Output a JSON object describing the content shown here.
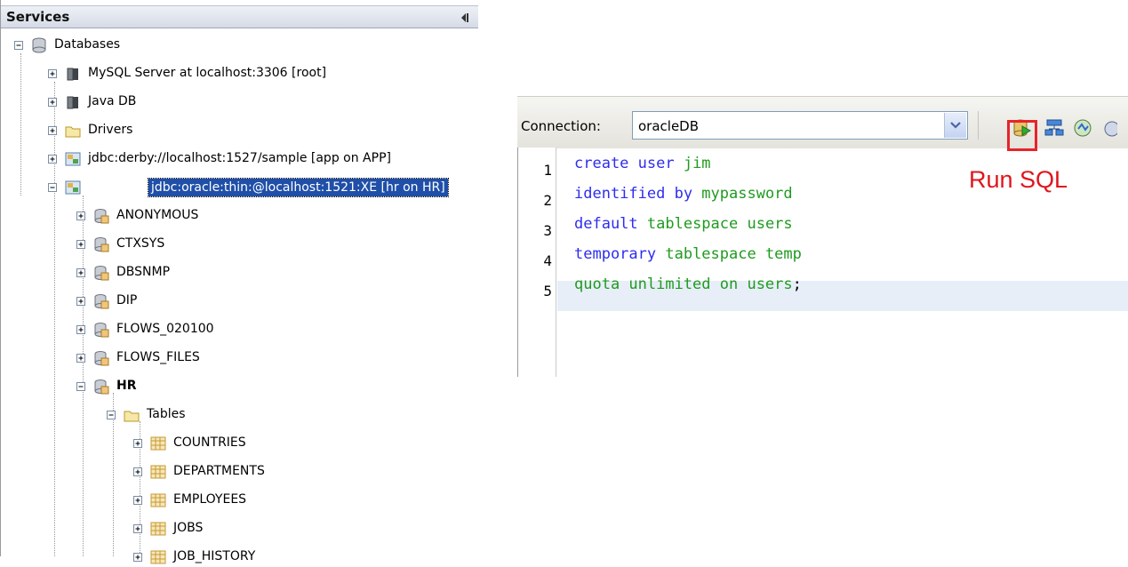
{
  "services": {
    "title": "Services",
    "tree": [
      {
        "label": "Databases",
        "icon": "database-icon"
      },
      {
        "label": "MySQL Server at localhost:3306 [root]",
        "icon": "mysql-server-icon"
      },
      {
        "label": "Java DB",
        "icon": "java-db-icon"
      },
      {
        "label": "Drivers",
        "icon": "folder-icon"
      },
      {
        "label": "jdbc:derby://localhost:1527/sample [app on APP]",
        "icon": "connection-icon"
      },
      {
        "label": "jdbc:oracle:thin:@localhost:1521:XE [hr on HR]",
        "icon": "connection-icon",
        "selected": true
      },
      {
        "label": "ANONYMOUS",
        "icon": "schema-icon"
      },
      {
        "label": "CTXSYS",
        "icon": "schema-icon"
      },
      {
        "label": "DBSNMP",
        "icon": "schema-icon"
      },
      {
        "label": "DIP",
        "icon": "schema-icon"
      },
      {
        "label": "FLOWS_020100",
        "icon": "schema-icon"
      },
      {
        "label": "FLOWS_FILES",
        "icon": "schema-icon"
      },
      {
        "label": "HR",
        "icon": "schema-icon",
        "bold": true
      },
      {
        "label": "Tables",
        "icon": "folder-icon"
      },
      {
        "label": "COUNTRIES",
        "icon": "table-icon"
      },
      {
        "label": "DEPARTMENTS",
        "icon": "table-icon"
      },
      {
        "label": "EMPLOYEES",
        "icon": "table-icon"
      },
      {
        "label": "JOBS",
        "icon": "table-icon"
      },
      {
        "label": "JOB_HISTORY",
        "icon": "table-icon"
      }
    ]
  },
  "editor": {
    "connection_label": "Connection:",
    "connection_value": "oracleDB",
    "annotation": "Run SQL",
    "line_numbers": [
      "1",
      "2",
      "3",
      "4",
      "5"
    ],
    "lines": [
      {
        "kw": "create user ",
        "txt": "jim",
        "punc": ""
      },
      {
        "kw": "identified by ",
        "txt": "mypassword",
        "punc": ""
      },
      {
        "kw": "default ",
        "txt": "tablespace users",
        "punc": ""
      },
      {
        "kw": "temporary ",
        "txt": "tablespace temp",
        "punc": ""
      },
      {
        "kw": "",
        "txt": "quota unlimited on users",
        "punc": ";"
      }
    ]
  },
  "colors": {
    "keyword": "#2d2df0",
    "text": "#1f9b1f",
    "selection": "#1f4fa8",
    "annotation": "#e0151b"
  }
}
